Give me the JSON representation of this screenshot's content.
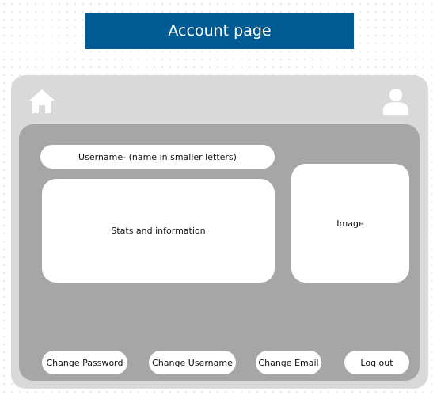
{
  "header": {
    "title": "Account page"
  },
  "nav": {
    "home_icon": "home-icon",
    "profile_icon": "user-icon"
  },
  "profile": {
    "username_label": "Username- (name in smaller letters)",
    "stats_label": "Stats and information",
    "image_label": "Image"
  },
  "actions": {
    "change_password": "Change Password",
    "change_username": "Change Username",
    "change_email": "Change Email",
    "log_out": "Log out"
  },
  "colors": {
    "banner": "#005a94",
    "frame": "#d9d9d9",
    "panel": "#a6a6a6",
    "card": "#ffffff"
  }
}
